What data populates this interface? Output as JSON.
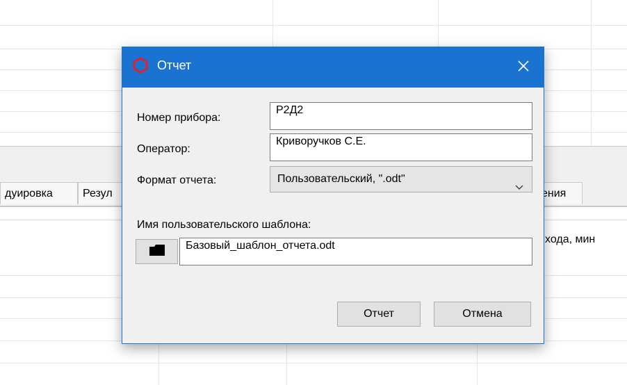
{
  "background": {
    "tabs": [
      "дуировка",
      "Резул",
      "ения"
    ],
    "column_fragment": "хода, мин"
  },
  "dialog": {
    "title": "Отчет",
    "accent_color": "#1a73d1",
    "icon": "hexagon-outline-icon",
    "fields": {
      "device_label": "Номер прибора:",
      "device_value": "Р2Д2",
      "operator_label": "Оператор:",
      "operator_value": "Криворучков С.Е.",
      "format_label": "Формат отчета:",
      "format_value": "Пользовательский, \".odt\"",
      "template_label": "Имя пользовательского шаблона:",
      "template_value": "Базовый_шаблон_отчета.odt"
    },
    "buttons": {
      "report": "Отчет",
      "cancel": "Отмена"
    }
  }
}
